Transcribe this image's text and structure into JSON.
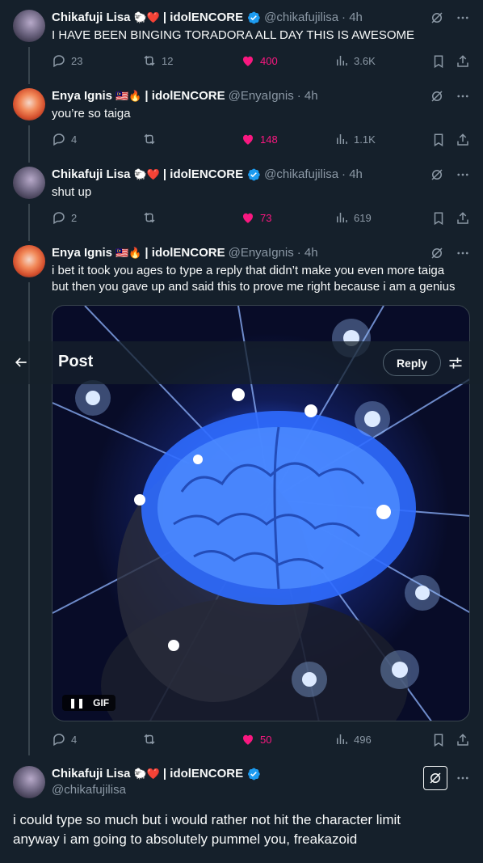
{
  "tweets": [
    {
      "name": "Chikafuji Lisa",
      "emojis": "🐑❤️",
      "group": "| idolENCORE",
      "verified": true,
      "handle": "@chikafujilisa",
      "time": "· 4h",
      "text": "I HAVE BEEN BINGING TORADORA ALL DAY THIS IS AWESOME",
      "replies": "23",
      "reposts": "12",
      "likes": "400",
      "views": "3.6K"
    },
    {
      "name": "Enya Ignis",
      "emojis": "🇲🇾🔥",
      "group": "| idolENCORE",
      "verified": false,
      "handle": "@EnyaIgnis",
      "time": "· 4h",
      "text": "you’re so taiga",
      "replies": "4",
      "reposts": "",
      "likes": "148",
      "views": "1.1K"
    },
    {
      "name": "Chikafuji Lisa",
      "emojis": "🐑❤️",
      "group": "| idolENCORE",
      "verified": true,
      "handle": "@chikafujilisa",
      "time": "· 4h",
      "text": "shut up",
      "replies": "2",
      "reposts": "",
      "likes": "73",
      "views": "619"
    },
    {
      "name": "Enya Ignis",
      "emojis": "🇲🇾🔥",
      "group": "| idolENCORE",
      "verified": false,
      "handle": "@EnyaIgnis",
      "time": "· 4h",
      "text_line1": "i bet it took you ages to type a reply that didn’t make you even more taiga",
      "text_line2": "but then you gave up and said this to prove me right because i am a genius",
      "gif_label": "GIF",
      "replies": "4",
      "reposts": "",
      "likes": "50",
      "views": "496"
    }
  ],
  "header": {
    "title": "Post",
    "reply_label": "Reply"
  },
  "main_post": {
    "name": "Chikafuji Lisa",
    "emojis": "🐑❤️",
    "group": "| idolENCORE",
    "handle": "@chikafujilisa",
    "text_line1": "i could type so much but i would rather not hit the character limit",
    "text_line2": "anyway i am going to absolutely pummel you, freakazoid"
  },
  "colors": {
    "background": "#15202b",
    "like": "#f91880",
    "muted": "#8b98a5",
    "verified": "#1d9bf0"
  }
}
